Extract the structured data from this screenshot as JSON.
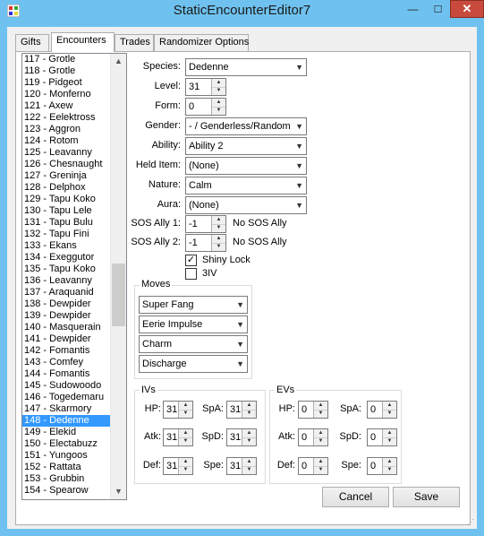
{
  "window": {
    "title": "StaticEncounterEditor7",
    "minimize_glyph": "—",
    "maximize_glyph": "☐",
    "close_glyph": "✕"
  },
  "tabs": [
    "Gifts",
    "Encounters",
    "Trades",
    "Randomizer Options"
  ],
  "encounter_list": {
    "items": [
      "117 - Grotle",
      "118 - Grotle",
      "119 - Pidgeot",
      "120 - Monferno",
      "121 - Axew",
      "122 - Eelektross",
      "123 - Aggron",
      "124 - Rotom",
      "125 - Leavanny",
      "126 - Chesnaught",
      "127 - Greninja",
      "128 - Delphox",
      "129 - Tapu Koko",
      "130 - Tapu Lele",
      "131 - Tapu Bulu",
      "132 - Tapu Fini",
      "133 - Ekans",
      "134 - Exeggutor",
      "135 - Tapu Koko",
      "136 - Leavanny",
      "137 - Araquanid",
      "138 - Dewpider",
      "139 - Dewpider",
      "140 - Masquerain",
      "141 - Dewpider",
      "142 - Fomantis",
      "143 - Comfey",
      "144 - Fomantis",
      "145 - Sudowoodo",
      "146 - Togedemaru",
      "147 - Skarmory",
      "148 - Dedenne",
      "149 - Elekid",
      "150 - Electabuzz",
      "151 - Yungoos",
      "152 - Rattata",
      "153 - Grubbin",
      "154 - Spearow"
    ],
    "selected_index": 31,
    "scroll_up_glyph": "▲",
    "scroll_down_glyph": "▼"
  },
  "form": {
    "species_label": "Species:",
    "species_value": "Dedenne",
    "level_label": "Level:",
    "level_value": "31",
    "form_label": "Form:",
    "form_value": "0",
    "gender_label": "Gender:",
    "gender_value": "- / Genderless/Random",
    "ability_label": "Ability:",
    "ability_value": "Ability 2",
    "helditem_label": "Held Item:",
    "helditem_value": "(None)",
    "nature_label": "Nature:",
    "nature_value": "Calm",
    "aura_label": "Aura:",
    "aura_value": "(None)",
    "sos1_label": "SOS Ally 1:",
    "sos1_value": "-1",
    "sos1_desc": "No SOS Ally",
    "sos2_label": "SOS Ally 2:",
    "sos2_value": "-1",
    "sos2_desc": "No SOS Ally",
    "shiny_label": "Shiny Lock",
    "shiny_checked": true,
    "threeiv_label": "3IV",
    "threeiv_checked": false,
    "check_glyph": "✓"
  },
  "moves": {
    "title": "Moves",
    "items": [
      "Super Fang",
      "Eerie Impulse",
      "Charm",
      "Discharge"
    ]
  },
  "ivs": {
    "title": "IVs",
    "hp_label": "HP:",
    "hp": "31",
    "atk_label": "Atk:",
    "atk": "31",
    "def_label": "Def:",
    "def": "31",
    "spa_label": "SpA:",
    "spa": "31",
    "spd_label": "SpD:",
    "spd": "31",
    "spe_label": "Spe:",
    "spe": "31"
  },
  "evs": {
    "title": "EVs",
    "hp_label": "HP:",
    "hp": "0",
    "atk_label": "Atk:",
    "atk": "0",
    "def_label": "Def:",
    "def": "0",
    "spa_label": "SpA:",
    "spa": "0",
    "spd_label": "SpD:",
    "spd": "0",
    "spe_label": "Spe:",
    "spe": "0"
  },
  "buttons": {
    "cancel": "Cancel",
    "save": "Save"
  },
  "glyphs": {
    "dropdown": "▼",
    "spin_up": "▲",
    "spin_down": "▼",
    "grip": "⋰"
  }
}
